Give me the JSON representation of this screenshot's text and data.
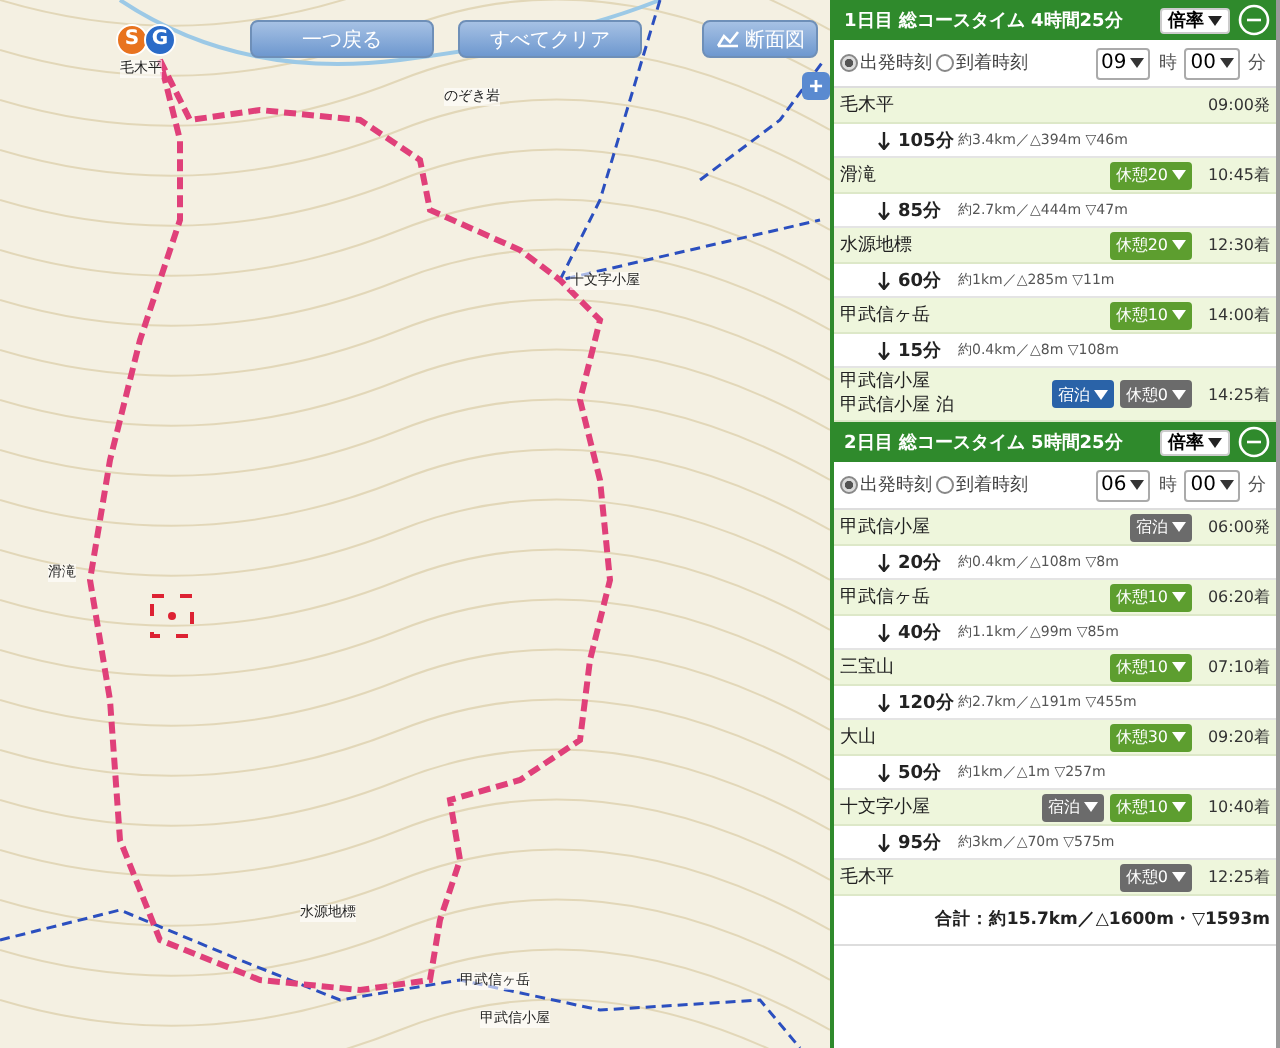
{
  "map": {
    "buttons": [
      {
        "label": "一つ戻る",
        "kind": "plain"
      },
      {
        "label": "すべてクリア",
        "kind": "plain"
      },
      {
        "label": "断面図",
        "kind": "profile"
      }
    ],
    "markers": [
      "S",
      "G"
    ],
    "labels": [
      "毛木平",
      "のぞき岩",
      "十文字小屋",
      "滑滝",
      "水源地標",
      "甲武信ヶ岳",
      "甲武信小屋"
    ],
    "zoom_button": "+"
  },
  "days": [
    {
      "title": "1日目 総コースタイム 4時間25分",
      "rate": "倍率",
      "options": [
        {
          "label": "出発時刻",
          "selected": true
        },
        {
          "label": "到着時刻",
          "selected": false
        }
      ],
      "hour": "09",
      "hour_unit": "時",
      "minute": "00",
      "minute_unit": "分",
      "stops": [
        {
          "name": "毛木平",
          "time": "09:00発"
        },
        {
          "name": "滑滝",
          "time": "10:45着",
          "buttons": [
            {
              "kind": "rest",
              "label": "休憩20",
              "active": true
            }
          ]
        },
        {
          "name": "水源地標",
          "time": "12:30着",
          "buttons": [
            {
              "kind": "rest",
              "label": "休憩20",
              "active": true
            }
          ]
        },
        {
          "name": "甲武信ヶ岳",
          "time": "14:00着",
          "buttons": [
            {
              "kind": "rest",
              "label": "休憩10",
              "active": true
            }
          ]
        },
        {
          "name": "甲武信小屋",
          "note": "甲武信小屋 泊",
          "time": "14:25着",
          "buttons": [
            {
              "kind": "stay",
              "label": "宿泊",
              "active": true
            },
            {
              "kind": "rest",
              "label": "休憩0",
              "active": false
            }
          ]
        }
      ],
      "segments": [
        {
          "duration": "105分",
          "detail": "約3.4km／△394m ▽46m"
        },
        {
          "duration": "85分",
          "detail": "約2.7km／△444m ▽47m"
        },
        {
          "duration": "60分",
          "detail": "約1km／△285m ▽11m"
        },
        {
          "duration": "15分",
          "detail": "約0.4km／△8m ▽108m"
        }
      ]
    },
    {
      "title": "2日目 総コースタイム 5時間25分",
      "rate": "倍率",
      "options": [
        {
          "label": "出発時刻",
          "selected": true
        },
        {
          "label": "到着時刻",
          "selected": false
        }
      ],
      "hour": "06",
      "hour_unit": "時",
      "minute": "00",
      "minute_unit": "分",
      "stops": [
        {
          "name": "甲武信小屋",
          "time": "06:00発",
          "buttons": [
            {
              "kind": "stay",
              "label": "宿泊",
              "active": false
            }
          ]
        },
        {
          "name": "甲武信ヶ岳",
          "time": "06:20着",
          "buttons": [
            {
              "kind": "rest",
              "label": "休憩10",
              "active": true
            }
          ]
        },
        {
          "name": "三宝山",
          "time": "07:10着",
          "buttons": [
            {
              "kind": "rest",
              "label": "休憩10",
              "active": true
            }
          ]
        },
        {
          "name": "大山",
          "time": "09:20着",
          "buttons": [
            {
              "kind": "rest",
              "label": "休憩30",
              "active": true
            }
          ]
        },
        {
          "name": "十文字小屋",
          "time": "10:40着",
          "buttons": [
            {
              "kind": "stay",
              "label": "宿泊",
              "active": false
            },
            {
              "kind": "rest",
              "label": "休憩10",
              "active": true
            }
          ]
        },
        {
          "name": "毛木平",
          "time": "12:25着",
          "buttons": [
            {
              "kind": "rest",
              "label": "休憩0",
              "active": false
            }
          ]
        }
      ],
      "segments": [
        {
          "duration": "20分",
          "detail": "約0.4km／△108m ▽8m"
        },
        {
          "duration": "40分",
          "detail": "約1.1km／△99m ▽85m"
        },
        {
          "duration": "120分",
          "detail": "約2.7km／△191m ▽455m"
        },
        {
          "duration": "50分",
          "detail": "約1km／△1m ▽257m"
        },
        {
          "duration": "95分",
          "detail": "約3km／△70m ▽575m"
        }
      ]
    }
  ],
  "total": "合計：約15.7km／△1600m・▽1593m"
}
